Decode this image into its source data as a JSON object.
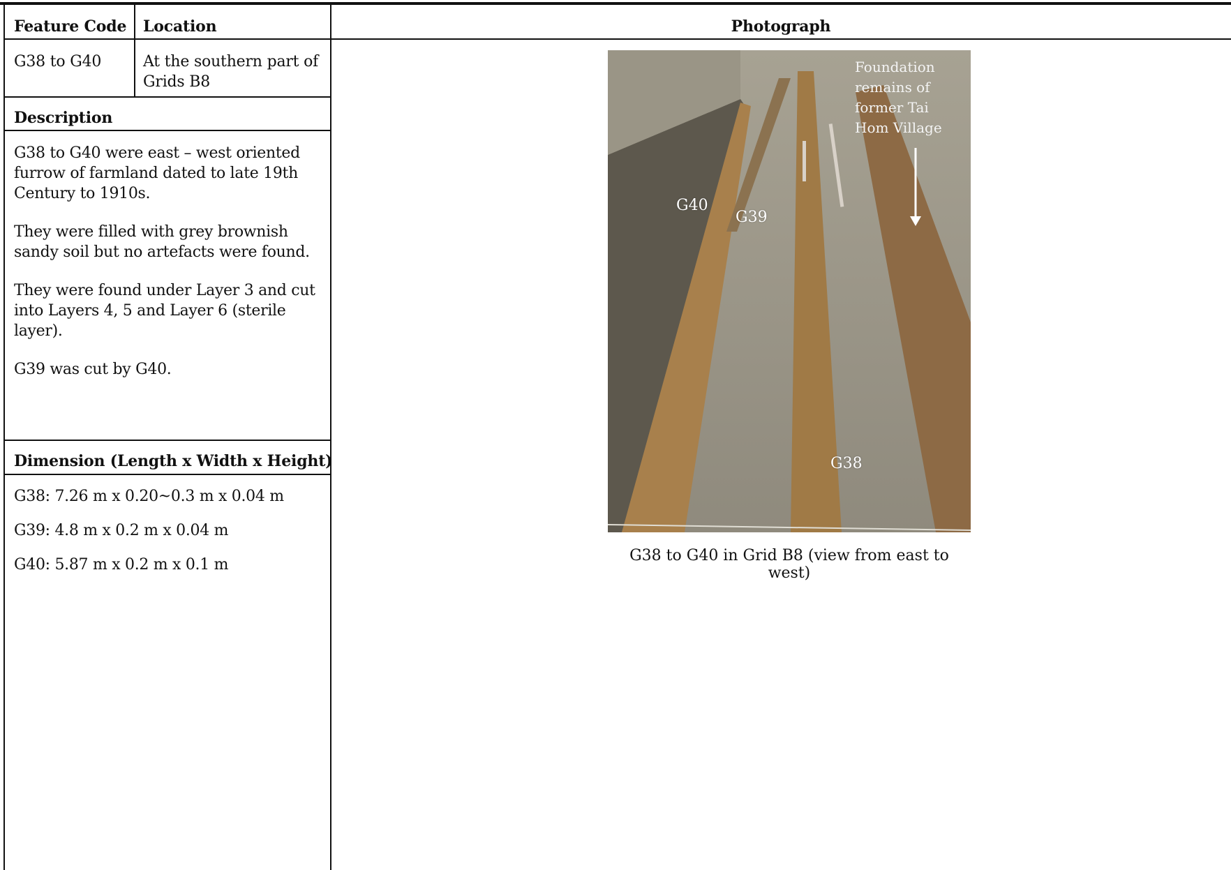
{
  "headers": {
    "feature_code": "Feature Code",
    "location": "Location",
    "photograph": "Photograph"
  },
  "record": {
    "feature_code": "G38 to G40",
    "location": "At the southern part of Grids B8"
  },
  "description": {
    "heading": "Description",
    "paragraphs": [
      "G38 to G40 were east – west oriented furrow of farmland dated to late 19th Century to 1910s.",
      "They were filled with grey brownish sandy soil but no artefacts were found.",
      "They were found under Layer 3 and cut into Layers 4, 5 and Layer 6 (sterile layer).",
      "G39 was cut by G40."
    ]
  },
  "dimension": {
    "heading": "Dimension (Length x Width x Height)",
    "items": [
      "G38: 7.26 m x 0.20~0.3 m x 0.04 m",
      "G39: 4.8 m x 0.2 m x 0.04 m",
      "G40: 5.87 m x 0.2 m x 0.1 m"
    ]
  },
  "photo": {
    "labels": {
      "g40": "G40",
      "g39": "G39",
      "g38": "G38"
    },
    "annotation": "Foundation remains of former Tai Hom Village",
    "caption": "G38 to G40 in Grid B8 (view from east to west)"
  }
}
